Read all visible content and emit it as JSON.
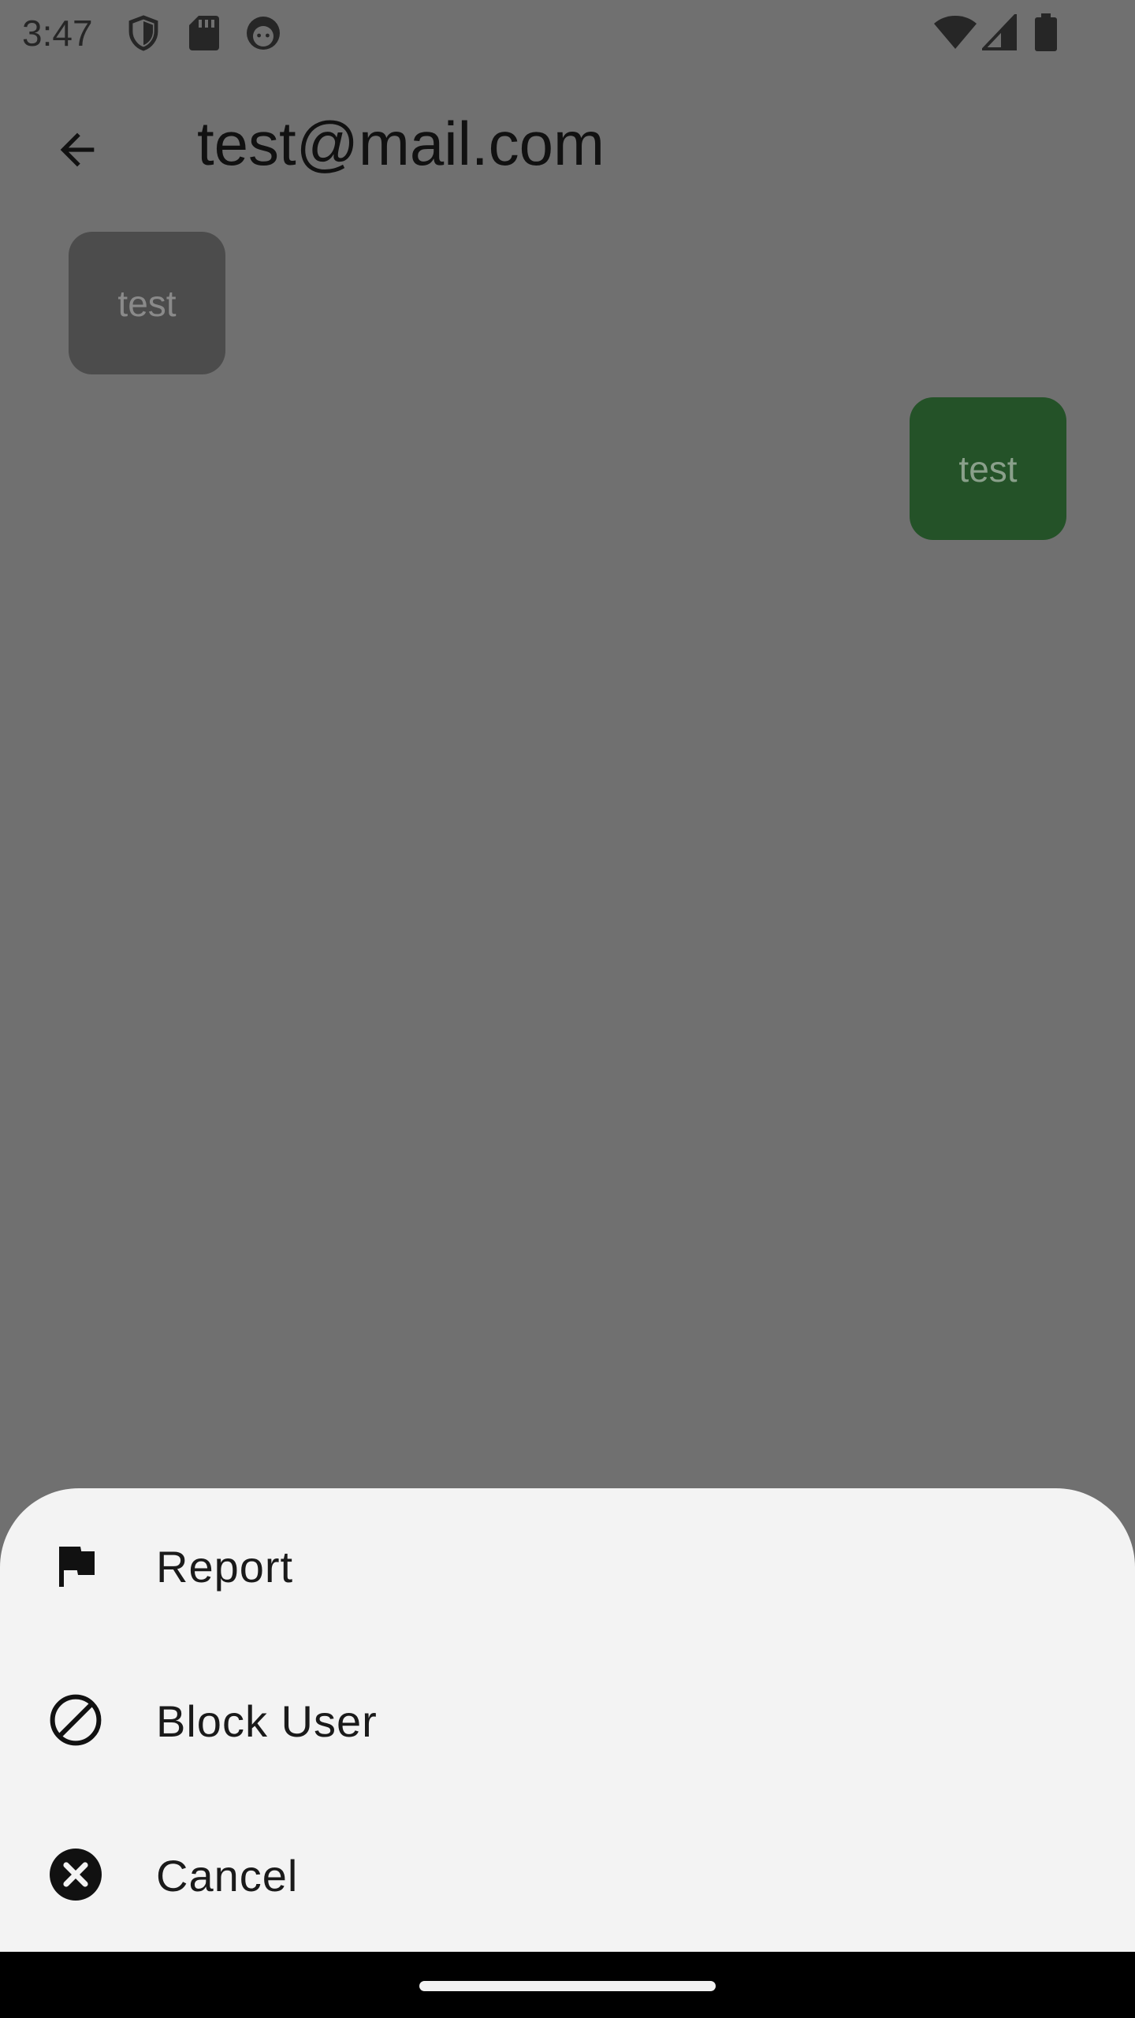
{
  "status_bar": {
    "time": "3:47",
    "left_icons": [
      "shield-icon",
      "sd-card-icon",
      "android-face-icon"
    ],
    "right_icons": [
      "wifi-icon",
      "cell-signal-icon",
      "battery-icon"
    ]
  },
  "app_bar": {
    "back_icon": "arrow-left-icon",
    "title": "test@mail.com"
  },
  "messages": [
    {
      "direction": "incoming",
      "text": "test",
      "bubble_color": "#4c4c4c"
    },
    {
      "direction": "outgoing",
      "text": "test",
      "bubble_color": "#245228"
    }
  ],
  "bottom_sheet": {
    "items": [
      {
        "icon": "flag-icon",
        "label": "Report"
      },
      {
        "icon": "block-icon",
        "label": "Block User"
      },
      {
        "icon": "cancel-icon",
        "label": "Cancel"
      }
    ]
  },
  "colors": {
    "scrim": "#707070",
    "sheet_background": "#f3f3f3",
    "nav_bar": "#000000"
  }
}
